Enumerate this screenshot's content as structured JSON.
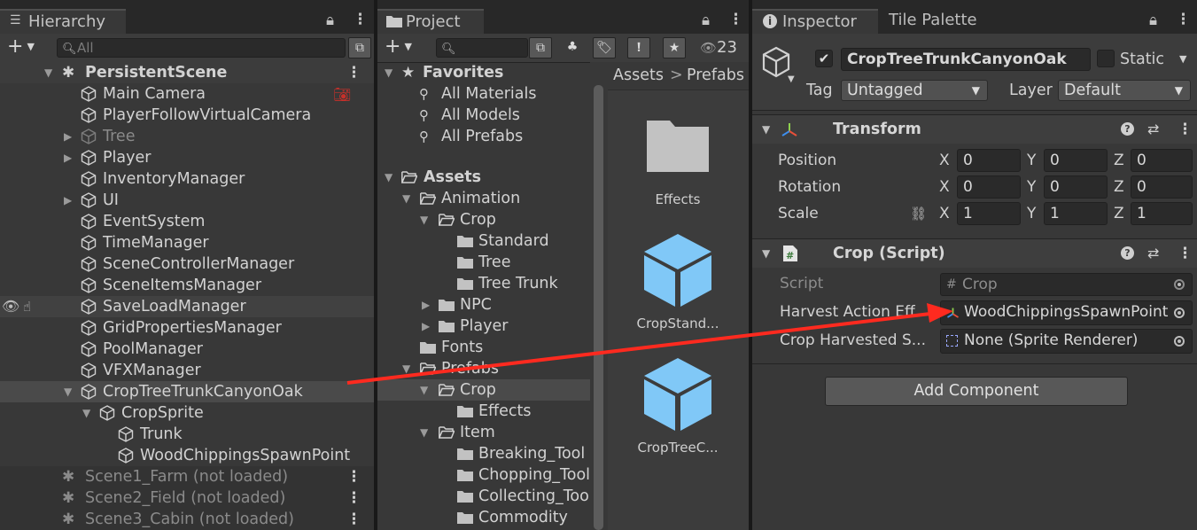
{
  "hierarchy": {
    "tab_label": "Hierarchy",
    "search_placeholder": "All",
    "add_label": "+",
    "rows": [
      {
        "label": "PersistentScene"
      },
      {
        "label": "Main Camera"
      },
      {
        "label": "PlayerFollowVirtualCamera"
      },
      {
        "label": "Tree"
      },
      {
        "label": "Player"
      },
      {
        "label": "InventoryManager"
      },
      {
        "label": "UI"
      },
      {
        "label": "EventSystem"
      },
      {
        "label": "TimeManager"
      },
      {
        "label": "SceneControllerManager"
      },
      {
        "label": "SceneItemsManager"
      },
      {
        "label": "SaveLoadManager"
      },
      {
        "label": "GridPropertiesManager"
      },
      {
        "label": "PoolManager"
      },
      {
        "label": "VFXManager"
      },
      {
        "label": "CropTreeTrunkCanyonOak"
      },
      {
        "label": "CropSprite"
      },
      {
        "label": "Trunk"
      },
      {
        "label": "WoodChippingsSpawnPoint"
      },
      {
        "label": "Scene1_Farm (not loaded)"
      },
      {
        "label": "Scene2_Field (not loaded)"
      },
      {
        "label": "Scene3_Cabin (not loaded)"
      }
    ]
  },
  "project": {
    "tab_label": "Project",
    "add_label": "+",
    "search_placeholder": "",
    "hidden_count": "23",
    "tree": [
      {
        "label": "Favorites"
      },
      {
        "label": "All Materials"
      },
      {
        "label": "All Models"
      },
      {
        "label": "All Prefabs"
      },
      {
        "label": "Assets"
      },
      {
        "label": "Animation"
      },
      {
        "label": "Crop"
      },
      {
        "label": "Standard"
      },
      {
        "label": "Tree"
      },
      {
        "label": "Tree Trunk"
      },
      {
        "label": "NPC"
      },
      {
        "label": "Player"
      },
      {
        "label": "Fonts"
      },
      {
        "label": "Prefabs"
      },
      {
        "label": "Crop"
      },
      {
        "label": "Effects"
      },
      {
        "label": "Item"
      },
      {
        "label": "Breaking_Tool"
      },
      {
        "label": "Chopping_Tool"
      },
      {
        "label": "Collecting_Tool"
      },
      {
        "label": "Commodity"
      }
    ],
    "breadcrumb": [
      "Assets",
      "Prefabs"
    ],
    "breadcrumb_sep": ">",
    "assets": [
      {
        "label": "Effects",
        "type": "folder"
      },
      {
        "label": "CropStand...",
        "type": "prefab"
      },
      {
        "label": "CropTreeC...",
        "type": "prefab"
      }
    ]
  },
  "inspector": {
    "tab_label": "Inspector",
    "tab2_label": "Tile Palette",
    "object_name": "CropTreeTrunkCanyonOak",
    "static_label": "Static",
    "tag_label": "Tag",
    "tag_value": "Untagged",
    "layer_label": "Layer",
    "layer_value": "Default",
    "transform": {
      "title": "Transform",
      "position_label": "Position",
      "rotation_label": "Rotation",
      "scale_label": "Scale",
      "x_label": "X",
      "y_label": "Y",
      "z_label": "Z",
      "position": [
        "0",
        "0",
        "0"
      ],
      "rotation": [
        "0",
        "0",
        "0"
      ],
      "scale": [
        "1",
        "1",
        "1"
      ]
    },
    "crop_script": {
      "title": "Crop (Script)",
      "script_label": "Script",
      "script_value": "Crop",
      "harvest_label": "Harvest Action Eff",
      "harvest_value": "WoodChippingsSpawnPoint",
      "harvested_label": "Crop Harvested S...",
      "harvested_value": "None (Sprite Renderer)"
    },
    "add_component_label": "Add Component"
  },
  "colors": {
    "panel_bg": "#383838",
    "tab_bg": "#282828",
    "field_bg": "#2a2a2a",
    "folder": "#c2c2c2",
    "prefab_blue": "#80c8f7",
    "arrow_red": "#ff2a1f"
  }
}
